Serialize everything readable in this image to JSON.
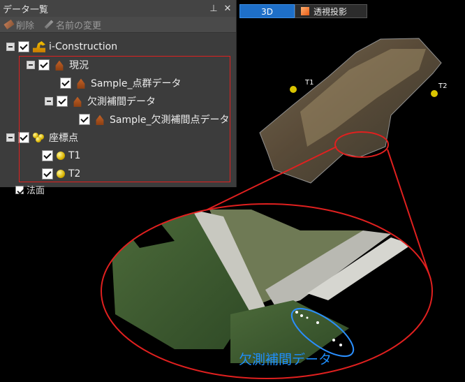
{
  "panel": {
    "title": "データ一覧",
    "pin_icon": "pin-icon",
    "close_icon": "close-icon",
    "toolbar": {
      "delete_label": "削除",
      "rename_label": "名前の変更"
    }
  },
  "tree": {
    "root": "i-Construction",
    "genkyo": "現況",
    "sample_points": "Sample_点群データ",
    "kesoku": "欠測補間データ",
    "sample_kesoku": "Sample_欠測補間点データ",
    "zahyo": "座標点",
    "t1": "T1",
    "t2": "T2",
    "next": "法面"
  },
  "viewer": {
    "tab_3d": "3D",
    "tab_persp": "透視投影",
    "t1": "T1",
    "t2": "T2",
    "callout": "欠測補間データ"
  },
  "colors": {
    "accent": "#1e6fc8",
    "highlight_red": "#e0201f",
    "callout_blue": "#1e8fff"
  }
}
